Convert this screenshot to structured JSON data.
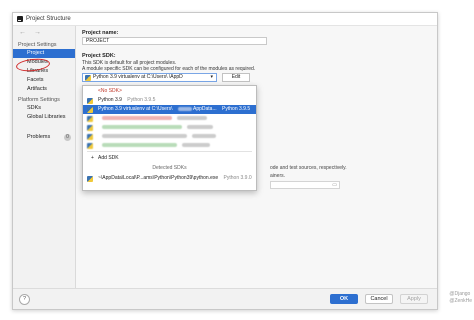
{
  "window": {
    "title": "Project Structure"
  },
  "nav": {
    "back_forward": "← →",
    "project_settings_header": "Project Settings",
    "project_settings": [
      "Project",
      "Modules",
      "Libraries",
      "Facets",
      "Artifacts"
    ],
    "platform_settings_header": "Platform Settings",
    "platform_settings": [
      "SDKs",
      "Global Libraries"
    ],
    "problems": "Problems",
    "problems_count": "0",
    "selected": "Project"
  },
  "content": {
    "project_name_label": "Project name:",
    "project_name_value": "PROJECT",
    "project_sdk_label": "Project SDK:",
    "sdk_desc_1": "This SDK is default for all project modules.",
    "sdk_desc_2": "A module specific SDK can be configured for each of the modules as required.",
    "sdk_selected": "Python 3.9 virtualenv at C:\\Users\\        \\AppD",
    "edit_label": "Edit",
    "hidden_text_1": "ode and test sources, respectively.",
    "hidden_text_2": "ainers."
  },
  "dropdown": {
    "no_sdk": "<No SDK>",
    "python_name": "Python 3.9",
    "python_version": "Python 3.9.5",
    "virtualenv_prefix": "Python 3.9 virtualenv at C:\\Users\\",
    "virtualenv_suffix": "AppData...",
    "virtualenv_version": "Python 3.9.5",
    "add_sdk": "Add SDK",
    "detected_header": "Detected SDKs",
    "detected_item": "~\\AppData\\Local\\P...ams\\Python\\Python39\\python.exe",
    "detected_version": "Python 3.9.0"
  },
  "buttons": {
    "help": "?",
    "ok": "OK",
    "cancel": "Cancel",
    "apply": "Apply"
  },
  "watermark": [
    "@Django",
    "@ZenkHe"
  ],
  "colors": {
    "selection": "#2d6fd0",
    "annotation_ring": "#d12a2a"
  }
}
